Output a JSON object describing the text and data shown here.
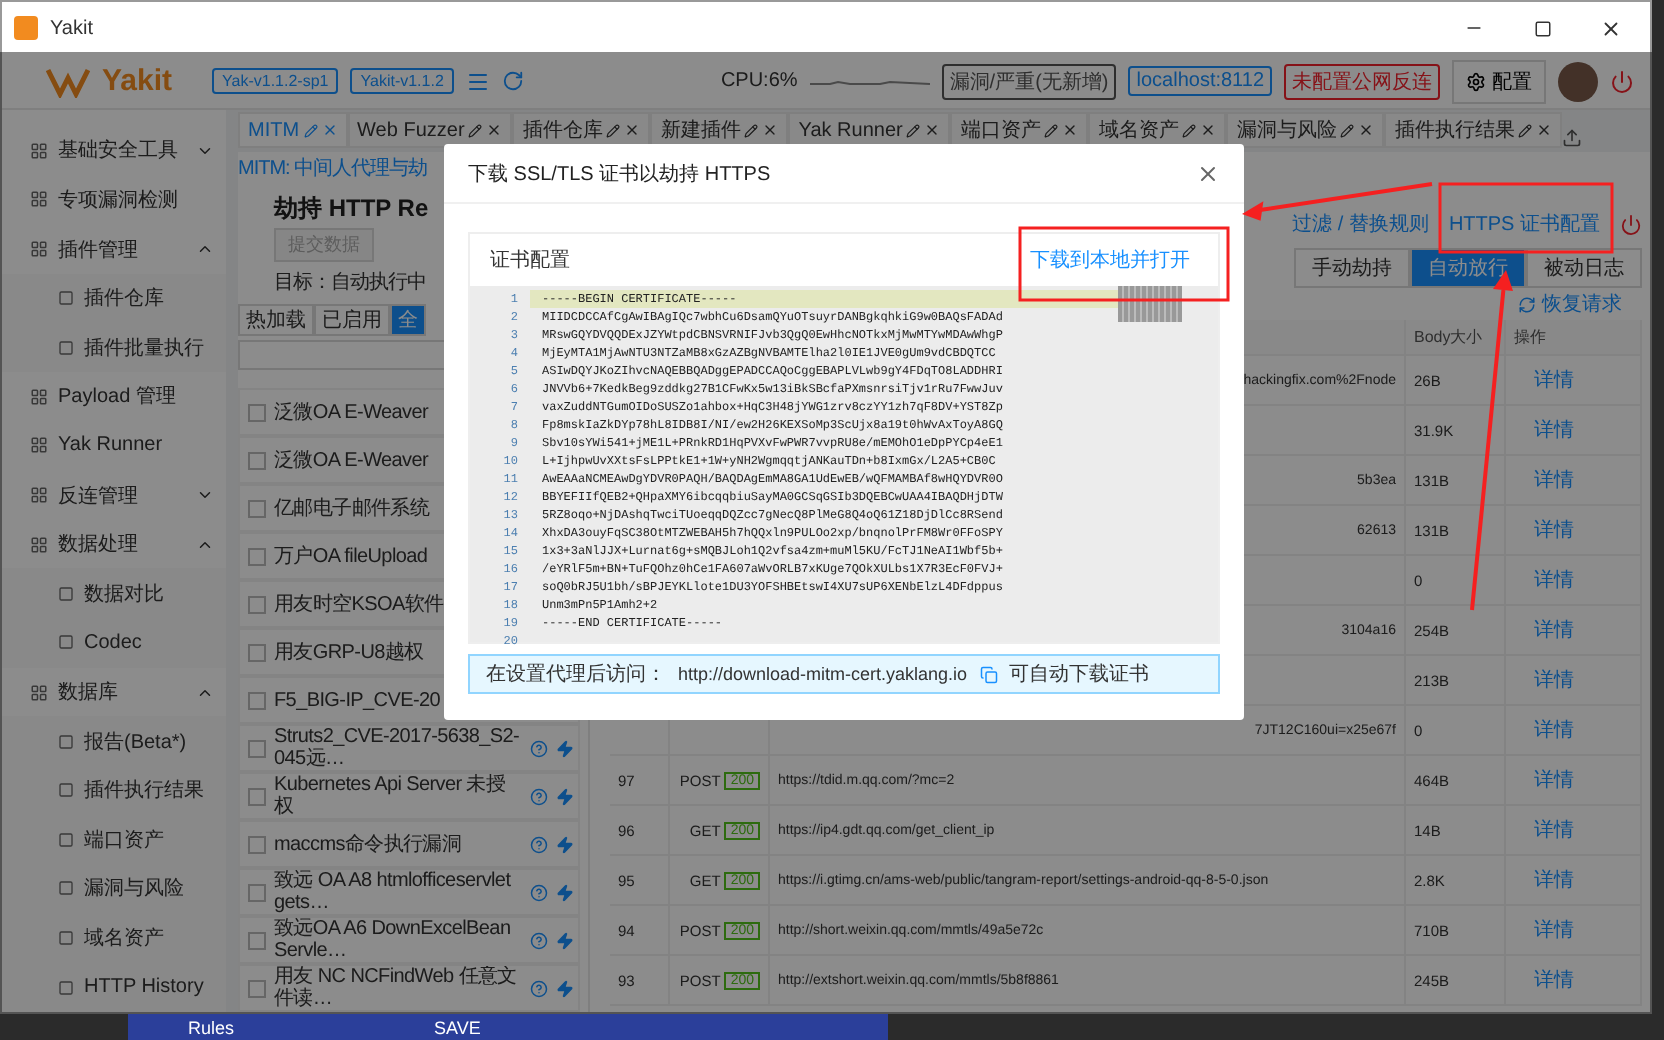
{
  "window": {
    "title": "Yakit"
  },
  "header": {
    "logo": "Yakit",
    "versions": [
      "Yak-v1.1.2-sp1",
      "Yakit-v1.1.2"
    ],
    "cpu": "CPU:6%",
    "risk": "漏洞/严重(无新增)",
    "host": "localhost:8112",
    "reverse": "未配置公网反连",
    "config": "配置"
  },
  "sidebar": {
    "items": [
      {
        "label": "基础安全工具",
        "expanded": false
      },
      {
        "label": "专项漏洞检测"
      },
      {
        "label": "插件管理",
        "expanded": true,
        "children": [
          {
            "label": "插件仓库"
          },
          {
            "label": "插件批量执行"
          }
        ]
      },
      {
        "label": "Payload 管理"
      },
      {
        "label": "Yak Runner"
      },
      {
        "label": "反连管理",
        "expanded": false
      },
      {
        "label": "数据处理",
        "expanded": true,
        "children": [
          {
            "label": "数据对比"
          },
          {
            "label": "Codec"
          }
        ]
      },
      {
        "label": "数据库",
        "expanded": true,
        "children": [
          {
            "label": "报告(Beta*)"
          },
          {
            "label": "插件执行结果"
          },
          {
            "label": "端口资产"
          },
          {
            "label": "漏洞与风险"
          },
          {
            "label": "域名资产"
          },
          {
            "label": "HTTP History"
          }
        ]
      }
    ]
  },
  "tabs": [
    {
      "label": "MITM",
      "selected": true
    },
    {
      "label": "Web Fuzzer",
      "selected": false
    },
    {
      "label": "插件仓库",
      "selected": false
    },
    {
      "label": "新建插件",
      "selected": false
    },
    {
      "label": "Yak Runner",
      "selected": false
    },
    {
      "label": "端口资产",
      "selected": false
    },
    {
      "label": "域名资产",
      "selected": false
    },
    {
      "label": "漏洞与风险",
      "selected": false
    },
    {
      "label": "插件执行结果",
      "selected": false
    }
  ],
  "breadcrumb": "MITM: 中间人代理与劫",
  "plugins": {
    "title": "劫持 HTTP Re",
    "button": "提交数据",
    "target": "目标：自动执行中",
    "filters": [
      {
        "label": "热加载",
        "selected": false
      },
      {
        "label": "已启用",
        "selected": false
      },
      {
        "label": "全",
        "selected": true
      }
    ],
    "items": [
      {
        "kind": "partial",
        "name": "泛微OA E-Weaver",
        "checked": false
      },
      {
        "kind": "partial",
        "name": "泛微OA E-Weaver",
        "checked": false
      },
      {
        "kind": "partial",
        "name": "亿邮电子邮件系统",
        "checked": false
      },
      {
        "kind": "partial",
        "name": "万户OA fileUpload",
        "checked": false
      },
      {
        "kind": "partial",
        "name": "用友时空KSOA软件",
        "checked": false
      },
      {
        "kind": "partial",
        "name": "用友GRP-U8越权",
        "checked": false
      },
      {
        "kind": "partial",
        "name": "F5_BIG-IP_CVE-20",
        "checked": false
      },
      {
        "kind": "full",
        "name": "Struts2_CVE-2017-5638_S2-045远…",
        "checked": false
      },
      {
        "kind": "full",
        "name": "Kubernetes Api Server 未授权",
        "checked": false
      },
      {
        "kind": "full",
        "name": "maccms命令执行漏洞",
        "checked": false
      },
      {
        "kind": "full",
        "name": "致远 OA A8 htmlofficeservlet gets…",
        "checked": false
      },
      {
        "kind": "full",
        "name": "致远OA A6 DownExcelBeanServle…",
        "checked": false
      },
      {
        "kind": "full",
        "name": "用友 NC NCFindWeb 任意文件读…",
        "checked": false
      }
    ]
  },
  "traffic": {
    "filter_link": "过滤 / 替换规则",
    "cert_link": "HTTPS 证书配置",
    "modes": [
      {
        "label": "手动劫持",
        "selected": false
      },
      {
        "label": "自动放行",
        "selected": true
      },
      {
        "label": "被动日志",
        "selected": false
      }
    ],
    "restore": "恢复请求",
    "columns": [
      "Body大小",
      "操作"
    ],
    "rows": [
      {
        "url": "hackingfix.com%2Fnode",
        "size": "26B",
        "action": "详情"
      },
      {
        "size": "31.9K",
        "action": "详情"
      },
      {
        "url": "5b3ea",
        "size": "131B",
        "action": "详情"
      },
      {
        "url": "62613",
        "size": "131B",
        "action": "详情"
      },
      {
        "size": "0",
        "action": "详情"
      },
      {
        "url": "3104a16",
        "size": "254B",
        "action": "详情"
      },
      {
        "size": "213B",
        "action": "详情"
      },
      {
        "url": "7JT12C160ui=x25e67f",
        "size": "0",
        "action": "详情"
      },
      {
        "index": "97",
        "method": "POST",
        "status": "200",
        "url": "https://tdid.m.qq.com/?mc=2",
        "size": "464B",
        "action": "详情"
      },
      {
        "index": "96",
        "method": "GET",
        "status": "200",
        "url": "https://ip4.gdt.qq.com/get_client_ip",
        "size": "14B",
        "action": "详情"
      },
      {
        "index": "95",
        "method": "GET",
        "status": "200",
        "url": "https://i.gtimg.cn/ams-web/public/tangram-report/settings-android-qq-8-5-0.json",
        "size": "2.8K",
        "action": "详情"
      },
      {
        "index": "94",
        "method": "POST",
        "status": "200",
        "url": "http://short.weixin.qq.com/mmtls/49a5e72c",
        "size": "710B",
        "action": "详情"
      },
      {
        "index": "93",
        "method": "POST",
        "status": "200",
        "url": "http://extshort.weixin.qq.com/mmtls/5b8f8861",
        "size": "245B",
        "action": "详情"
      }
    ]
  },
  "modal": {
    "title": "下载 SSL/TLS 证书以劫持 HTTPS",
    "card_title": "证书配置",
    "download": "下载到本地并打开",
    "lines": [
      {
        "no": "1",
        "text": "-----BEGIN CERTIFICATE-----"
      },
      {
        "no": "2",
        "text": "MIIDCDCCAfCgAwIBAgIQc7wbhCu6DsamQYuOTsuyrDANBgkqhkiG9w0BAQsFADAd"
      },
      {
        "no": "3",
        "text": "MRswGQYDVQQDExJZYWtpdCBNSVRNIFJvb3QgQ0EwHhcNOTkxMjMwMTYwMDAwWhgP"
      },
      {
        "no": "4",
        "text": "MjEyMTA1MjAwNTU3NTZaMB8xGzAZBgNVBAMTElha2l0IE1JVE0gUm9vdCBDQTCC"
      },
      {
        "no": "5",
        "text": "ASIwDQYJKoZIhvcNAQEBBQADggEPADCCAQoCggEBAPLVLwb9gY4FDqTO8LADDHRI"
      },
      {
        "no": "6",
        "text": "JNVVb6+7KedkBeg9zddkg27B1CFwKx5w13iBkSBcfaPXmsnrsiTjv1rRu7FwwJuv"
      },
      {
        "no": "7",
        "text": "vaxZuddNTGumOIDoSUSZo1ahbox+HqC3H48jYWG1zrv8czYY1zh7qF8DV+YST8Zp"
      },
      {
        "no": "8",
        "text": "Fp8mskIaZkDYp78hL8IDB8I/NI/ew2H26KEXSoMp3ScUjx8a19t0hWvAxToyA8GQ"
      },
      {
        "no": "9",
        "text": "Sbv10sYWi541+jME1L+PRnkRD1HqPVXvFwPWR7vvpRU8e/mEMOhO1eDpPYCp4eE1"
      },
      {
        "no": "10",
        "text": "L+IjhpwUvXXtsFsLPPtkE1+1W+yNH2WgmqqtjANKauTDn+b8IxmGx/L2A5+CB0C"
      },
      {
        "no": "11",
        "text": "AwEAAaNCMEAwDgYDVR0PAQH/BAQDAgEmMA8GA1UdEwEB/wQFMAMBAf8wHQYDVR0O"
      },
      {
        "no": "12",
        "text": "BBYEFIIfQEB2+QHpaXMY6ibcqqbiuSayMA0GCSqGSIb3DQEBCwUAA4IBAQDHjDTW"
      },
      {
        "no": "13",
        "text": "5RZ8oqo+NjDAshqTwciTUoeqqDQZcc7gNecQ8PlMeG8Q4oQ61Z18DjDlCc8RSend"
      },
      {
        "no": "14",
        "text": "XhxDA3ouyFqSC38OtMTZWEBAH5h7hQQxln9PULOo2xp/bnqnolPrFM8Wr0FFoSPY"
      },
      {
        "no": "15",
        "text": "1x3+3aNlJJX+Lurnat6g+sMQBJLoh1Q2vfsa4zm+muMl5KU/FcTJ1NeAI1Wbf5b+"
      },
      {
        "no": "16",
        "text": "/eYRlF5m+BN+TuFQOhz0hCe1FA607aWvORLB7xKUge7QOkXULbs1X7R3EcF0FVJ+"
      },
      {
        "no": "17",
        "text": "soQ0bRJ5U1bh/sBPJEYKLlote1DU3YOFSHBEtswI4XU7sUP6XENbElzL4DFdppus"
      },
      {
        "no": "18",
        "text": "Unm3mPn5P1Amh2+2"
      },
      {
        "no": "19",
        "text": "-----END CERTIFICATE-----"
      },
      {
        "no": "20"
      }
    ],
    "hint_label": "在设置代理后访问：",
    "hint_url": "http://download-mitm-cert.yaklang.io",
    "hint_tail": "可自动下载证书"
  },
  "taskbar": {
    "items": [
      "Rules",
      "SAVE"
    ]
  }
}
